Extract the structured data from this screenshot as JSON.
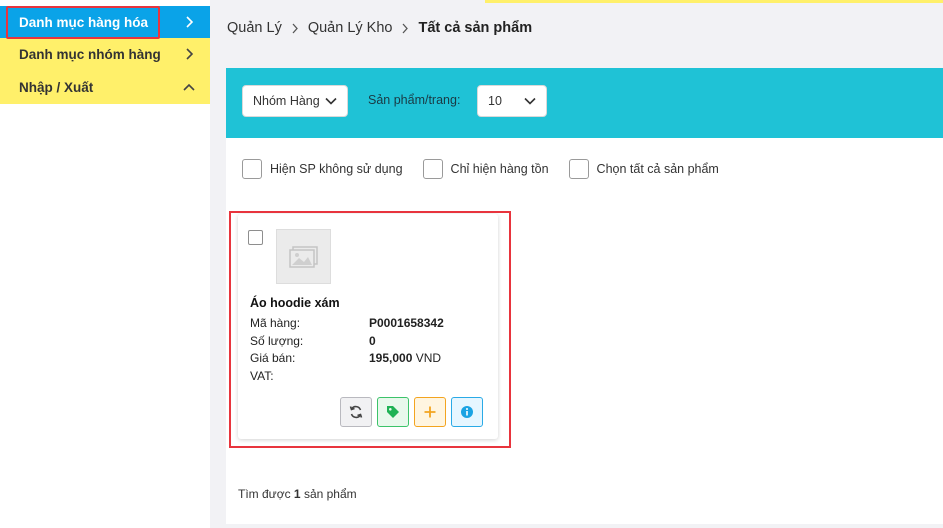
{
  "sidebar": {
    "items": [
      {
        "label": "Danh mục hàng hóa",
        "icon": "chevron-right-icon",
        "active": true
      },
      {
        "label": "Danh mục nhóm hàng",
        "icon": "chevron-right-icon"
      },
      {
        "label": "Nhập / Xuất",
        "icon": "chevron-up-icon"
      }
    ]
  },
  "breadcrumb": {
    "items": [
      "Quản Lý",
      "Quản Lý Kho"
    ],
    "current": "Tất cả sản phẩm"
  },
  "toolbar": {
    "group_select": "Nhóm Hàng",
    "per_page_label": "Sản phẩm/trang:",
    "per_page_value": "10"
  },
  "filters": {
    "show_unused": "Hiện SP không sử dụng",
    "only_in_stock": "Chỉ hiện hàng tồn",
    "select_all": "Chọn tất cả sản phẩm"
  },
  "product": {
    "name": "Áo hoodie xám",
    "code_label": "Mã hàng:",
    "code": "P0001658342",
    "qty_label": "Số lượng:",
    "qty": "0",
    "price_label": "Giá bán:",
    "price": "195,000",
    "currency": "VND",
    "vat_label": "VAT:",
    "actions": [
      "sync-icon",
      "tag-icon",
      "plus-icon",
      "info-icon"
    ]
  },
  "result": {
    "prefix": "Tìm được",
    "count": "1",
    "suffix": "sản phẩm"
  },
  "colors": {
    "active_nav": "#0aa3e8",
    "nav_highlight": "#fff06a",
    "toolbar": "#1fc2d6",
    "outline": "#e8343d"
  }
}
